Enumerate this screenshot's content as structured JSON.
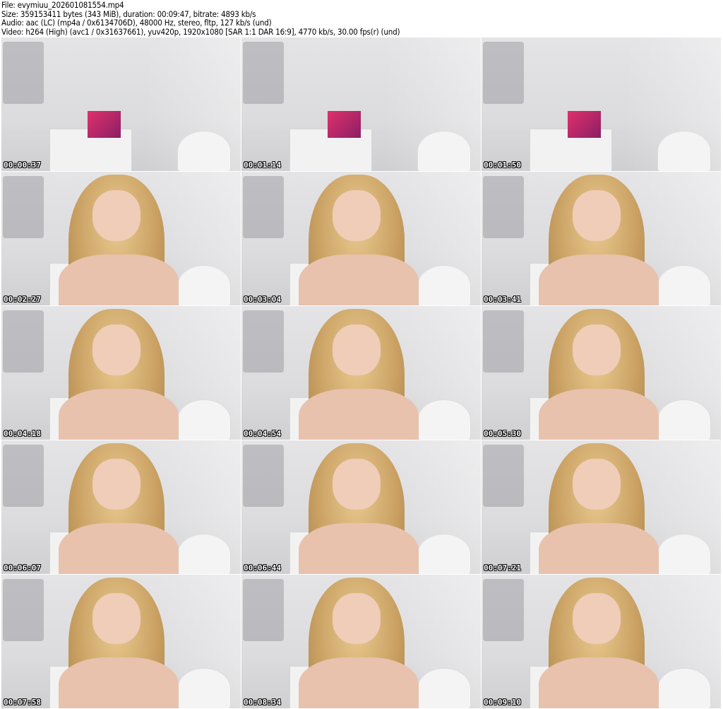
{
  "info": {
    "file": "File: evymiuu_202601081554.mp4",
    "size": "Size: 359153411 bytes (343 MiB), duration: 00:09:47, bitrate: 4893 kb/s",
    "audio": "Audio: aac (LC) (mp4a / 0x6134706D), 48000 Hz, stereo, fltp, 127 kb/s (und)",
    "video": "Video: h264 (High) (avc1 / 0x31637661), yuv420p, 1920x1080 [SAR 1:1 DAR 16:9], 4770 kb/s, 30.00 fps(r) (und)"
  },
  "thumbnails": [
    {
      "timestamp": "00:00:37",
      "person": false
    },
    {
      "timestamp": "00:01:14",
      "person": false
    },
    {
      "timestamp": "00:01:50",
      "person": false
    },
    {
      "timestamp": "00:02:27",
      "person": true
    },
    {
      "timestamp": "00:03:04",
      "person": true
    },
    {
      "timestamp": "00:03:41",
      "person": true
    },
    {
      "timestamp": "00:04:18",
      "person": true
    },
    {
      "timestamp": "00:04:54",
      "person": true
    },
    {
      "timestamp": "00:05:30",
      "person": true
    },
    {
      "timestamp": "00:06:07",
      "person": true
    },
    {
      "timestamp": "00:06:44",
      "person": true
    },
    {
      "timestamp": "00:07:21",
      "person": true
    },
    {
      "timestamp": "00:07:58",
      "person": true
    },
    {
      "timestamp": "00:08:34",
      "person": true
    },
    {
      "timestamp": "00:09:10",
      "person": true
    }
  ]
}
